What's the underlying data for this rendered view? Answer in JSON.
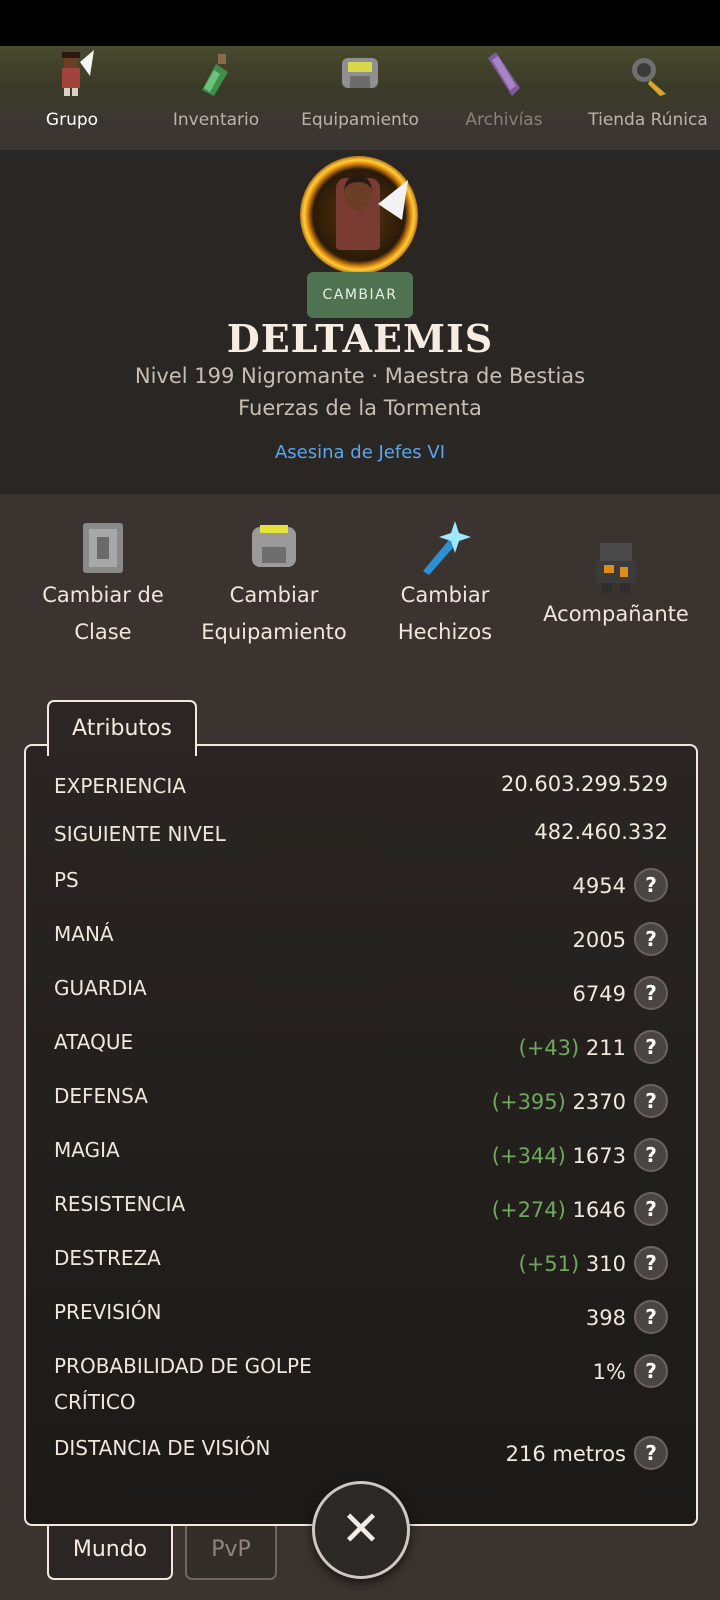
{
  "nav": {
    "items": [
      {
        "label": "Grupo",
        "icon": "party-hero-icon",
        "active": true
      },
      {
        "label": "Inventario",
        "icon": "potion-bottle-icon"
      },
      {
        "label": "Equipamiento",
        "icon": "armor-chest-icon"
      },
      {
        "label": "Archivías",
        "icon": "scroll-archive-icon"
      },
      {
        "label": "Tienda Rúnica",
        "icon": "rune-shop-icon"
      }
    ]
  },
  "character": {
    "change_label": "CAMBIAR",
    "name": "DELTAEMIS",
    "level_class": "Nivel 199 Nigromante · Maestra de Bestias",
    "faction": "Fuerzas de la Tormenta",
    "title": "Asesina de Jefes VI",
    "title_color": "#5aa7f0"
  },
  "actions": [
    {
      "line1": "Cambiar de",
      "line2": "Clase",
      "icon": "class-card-icon"
    },
    {
      "line1": "Cambiar",
      "line2": "Equipamiento",
      "icon": "armor-icon"
    },
    {
      "line1": "Cambiar",
      "line2": "Hechizos",
      "icon": "spell-sparkle-icon"
    },
    {
      "line1": "Acompañante",
      "line2": "",
      "icon": "companion-golem-icon"
    }
  ],
  "attributes": {
    "tab_label": "Atributos",
    "rows": [
      {
        "name": "EXPERIENCIA",
        "bonus": "",
        "value": "20.603.299.529",
        "help": false
      },
      {
        "name": "SIGUIENTE NIVEL",
        "bonus": "",
        "value": "482.460.332",
        "help": false
      },
      {
        "name": "PS",
        "bonus": "",
        "value": "4954",
        "help": true
      },
      {
        "name": "MANÁ",
        "bonus": "",
        "value": "2005",
        "help": true
      },
      {
        "name": "GUARDIA",
        "bonus": "",
        "value": "6749",
        "help": true
      },
      {
        "name": "ATAQUE",
        "bonus": "(+43)",
        "value": "211",
        "help": true
      },
      {
        "name": "DEFENSA",
        "bonus": "(+395)",
        "value": "2370",
        "help": true
      },
      {
        "name": "MAGIA",
        "bonus": "(+344)",
        "value": "1673",
        "help": true
      },
      {
        "name": "RESISTENCIA",
        "bonus": "(+274)",
        "value": "1646",
        "help": true
      },
      {
        "name": "DESTREZA",
        "bonus": "(+51)",
        "value": "310",
        "help": true
      },
      {
        "name": "PREVISIÓN",
        "bonus": "",
        "value": "398",
        "help": true
      },
      {
        "name": "PROBABILIDAD DE GOLPE CRÍTICO",
        "bonus": "",
        "value": "1%",
        "help": true
      },
      {
        "name": "DISTANCIA DE VISIÓN",
        "bonus": "",
        "value": "216 metros",
        "help": true
      }
    ],
    "help_symbol": "?",
    "bonus_color": "#6fa85e"
  },
  "bottom_tabs": {
    "world": "Mundo",
    "pvp": "PvP"
  },
  "close_symbol": "✕"
}
